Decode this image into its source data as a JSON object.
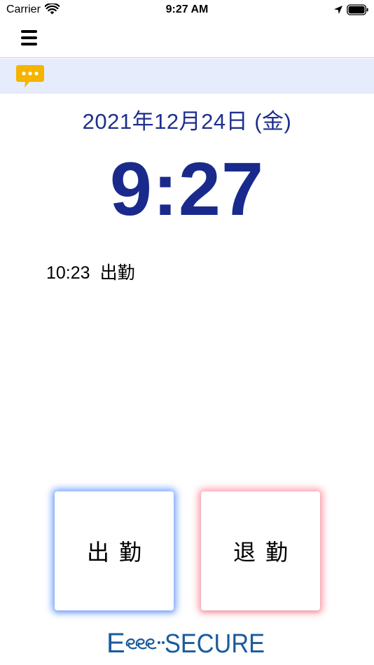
{
  "status_bar": {
    "carrier": "Carrier",
    "time": "9:27 AM"
  },
  "message_bar": {
    "icon": "chat-bubble-icon",
    "accent_color": "#f5b400"
  },
  "main": {
    "date": "2021年12月24日 (金)",
    "current_time": "9:27",
    "records": [
      {
        "time": "10:23",
        "type": "出勤"
      }
    ]
  },
  "buttons": {
    "clock_in": "出勤",
    "clock_out": "退勤"
  },
  "brand": {
    "logo_text_e": "E",
    "logo_text_secure": "SECURE",
    "logo_color": "#1b5b9b"
  },
  "colors": {
    "primary": "#1a2a8c",
    "message_bar_bg": "#e6ecfb",
    "clock_in_glow": "#5088ff",
    "clock_out_glow": "#ff6e82"
  }
}
